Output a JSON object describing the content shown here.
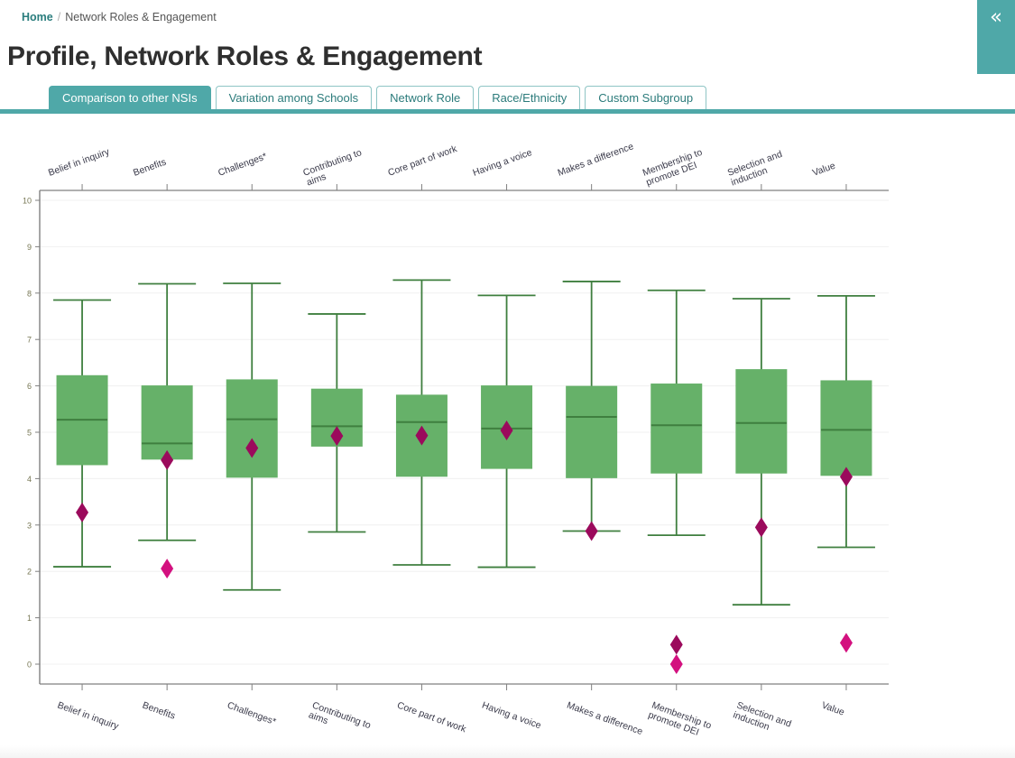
{
  "breadcrumb": {
    "home_label": "Home",
    "separator": "/",
    "current_label": "Network Roles & Engagement"
  },
  "page_title": "Profile, Network Roles & Engagement",
  "collapse_handle": {
    "icon": "double-chevron-left-icon",
    "glyph": "«"
  },
  "tabs": [
    {
      "label": "Comparison to other NSIs",
      "active": true
    },
    {
      "label": "Variation among Schools",
      "active": false
    },
    {
      "label": "Network Role",
      "active": false
    },
    {
      "label": "Race/Ethnicity",
      "active": false
    },
    {
      "label": "Custom Subgroup",
      "active": false
    }
  ],
  "colors": {
    "brand_teal": "#4fa8a8",
    "box_fill": "#66b169",
    "box_stroke": "#3f7f3f",
    "whisker": "#3f7f3f",
    "marker_dark": "#9b0a5c",
    "marker_bright": "#d3117f",
    "axis": "#808080",
    "gridline": "#f0f0f0",
    "tick_text": "#777754"
  },
  "chart_data": {
    "type": "box",
    "title": "",
    "xlabel": "",
    "ylabel": "",
    "ylim": [
      0,
      10.4
    ],
    "yticks": [
      0,
      1,
      2,
      3,
      4,
      5,
      6,
      7,
      8,
      9,
      10
    ],
    "grid": true,
    "legend": "none",
    "categories": [
      "Belief in inquiry",
      "Benefits",
      "Challenges*",
      "Contributing to aims",
      "Core part of work",
      "Having a voice",
      "Makes a difference",
      "Membership to promote DEI",
      "Selection and induction",
      "Value"
    ],
    "boxes": [
      {
        "category": "Belief in inquiry",
        "whisker_low": 2.1,
        "q1": 4.3,
        "median": 5.27,
        "q3": 6.22,
        "whisker_high": 7.85,
        "markers": [
          3.27
        ]
      },
      {
        "category": "Benefits",
        "whisker_low": 2.67,
        "q1": 4.42,
        "median": 4.76,
        "q3": 6.0,
        "whisker_high": 8.2,
        "markers": [
          4.4,
          2.06
        ]
      },
      {
        "category": "Challenges*",
        "whisker_low": 1.6,
        "q1": 4.03,
        "median": 5.28,
        "q3": 6.13,
        "whisker_high": 8.21,
        "markers": [
          4.66
        ]
      },
      {
        "category": "Contributing to aims",
        "whisker_low": 2.85,
        "q1": 4.7,
        "median": 5.13,
        "q3": 5.93,
        "whisker_high": 7.55,
        "markers": [
          4.92
        ]
      },
      {
        "category": "Core part of work",
        "whisker_low": 2.14,
        "q1": 4.05,
        "median": 5.22,
        "q3": 5.8,
        "whisker_high": 8.28,
        "markers": [
          4.93
        ]
      },
      {
        "category": "Having a voice",
        "whisker_low": 2.09,
        "q1": 4.22,
        "median": 5.08,
        "q3": 6.0,
        "whisker_high": 7.95,
        "markers": [
          5.04
        ]
      },
      {
        "category": "Makes a difference",
        "whisker_low": 2.87,
        "q1": 4.02,
        "median": 5.33,
        "q3": 5.99,
        "whisker_high": 8.25,
        "markers": [
          2.87
        ]
      },
      {
        "category": "Membership to promote DEI",
        "whisker_low": 2.78,
        "q1": 4.12,
        "median": 5.15,
        "q3": 6.04,
        "whisker_high": 8.06,
        "markers": [
          0.42,
          0.0
        ]
      },
      {
        "category": "Selection and induction",
        "whisker_low": 1.28,
        "q1": 4.12,
        "median": 5.2,
        "q3": 6.35,
        "whisker_high": 7.88,
        "markers": [
          2.95
        ]
      },
      {
        "category": "Value",
        "whisker_low": 2.52,
        "q1": 4.07,
        "median": 5.05,
        "q3": 6.11,
        "whisker_high": 7.94,
        "markers": [
          4.04,
          0.46
        ]
      }
    ]
  }
}
